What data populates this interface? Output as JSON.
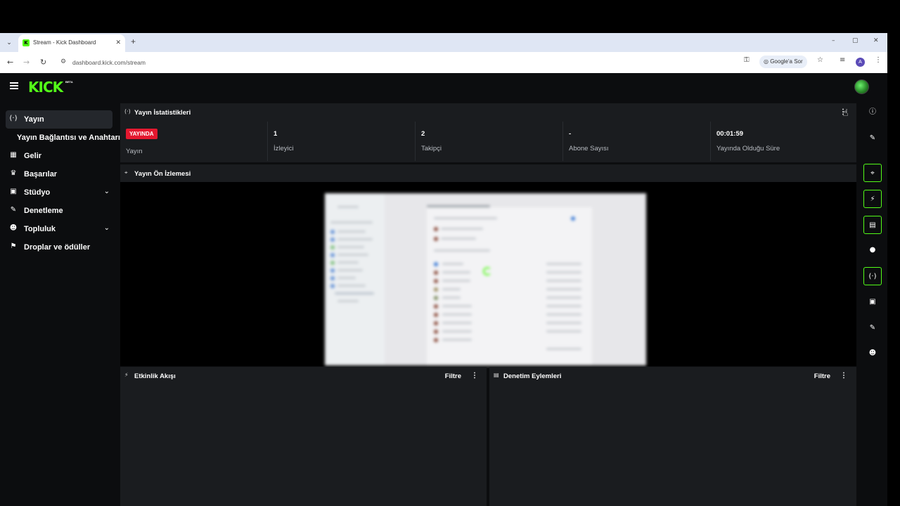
{
  "browser": {
    "tab_title": "Stream - Kick Dashboard",
    "tab_favicon": "K",
    "new_tab_symbol": "+",
    "url": "dashboard.kick.com/stream",
    "google_ask_label": "Google'a Sor",
    "profile_initial": "A",
    "window_controls": {
      "minimize": "–",
      "maximize": "▢",
      "close": "✕"
    },
    "nav": {
      "back": "←",
      "forward": "→",
      "reload": "↻"
    }
  },
  "app": {
    "logo_text": "KICK",
    "logo_badge": "BETA",
    "accent_color": "#53fc18",
    "live_color": "#e3182f"
  },
  "sidebar": {
    "items": [
      {
        "label": "Yayın",
        "icon": "broadcast-icon",
        "active": true
      },
      {
        "label": "Yayın Bağlantısı ve Anahtarı",
        "icon": "",
        "active": false
      },
      {
        "label": "Gelir",
        "icon": "revenue-icon",
        "active": false
      },
      {
        "label": "Başarılar",
        "icon": "trophy-icon",
        "active": false
      },
      {
        "label": "Stüdyo",
        "icon": "studio-icon",
        "active": false,
        "expandable": true
      },
      {
        "label": "Denetleme",
        "icon": "wrench-icon",
        "active": false
      },
      {
        "label": "Topluluk",
        "icon": "community-icon",
        "active": false,
        "expandable": true
      },
      {
        "label": "Droplar ve ödüller",
        "icon": "gift-icon",
        "active": false
      }
    ]
  },
  "stats_panel": {
    "title": "Yayın İstatistikleri",
    "cells": [
      {
        "value": "YAYINDA",
        "label": "Yayın",
        "is_badge": true
      },
      {
        "value": "1",
        "label": "İzleyici"
      },
      {
        "value": "2",
        "label": "Takipçi"
      },
      {
        "value": "-",
        "label": "Abone Sayısı"
      },
      {
        "value": "00:01:59",
        "label": "Yayında Olduğu Süre"
      }
    ]
  },
  "preview_panel": {
    "title": "Yayın Ön İzlemesi"
  },
  "activity_panel": {
    "title": "Etkinlik Akışı",
    "filter_label": "Filtre"
  },
  "moderation_panel": {
    "title": "Denetim Eylemleri",
    "filter_label": "Filtre"
  },
  "right_rail": {
    "buttons": [
      {
        "icon": "info-icon",
        "boxed": false
      },
      {
        "icon": "pencil-icon",
        "boxed": false
      },
      {
        "icon": "preview-icon",
        "boxed": true
      },
      {
        "icon": "lightning-icon",
        "boxed": true
      },
      {
        "icon": "moderation-icon",
        "boxed": true
      },
      {
        "icon": "chat-icon",
        "boxed": false
      },
      {
        "icon": "broadcast-icon",
        "boxed": true
      },
      {
        "icon": "studio-icon",
        "boxed": false
      },
      {
        "icon": "wrench-icon",
        "boxed": false
      },
      {
        "icon": "community-icon",
        "boxed": false
      }
    ]
  }
}
